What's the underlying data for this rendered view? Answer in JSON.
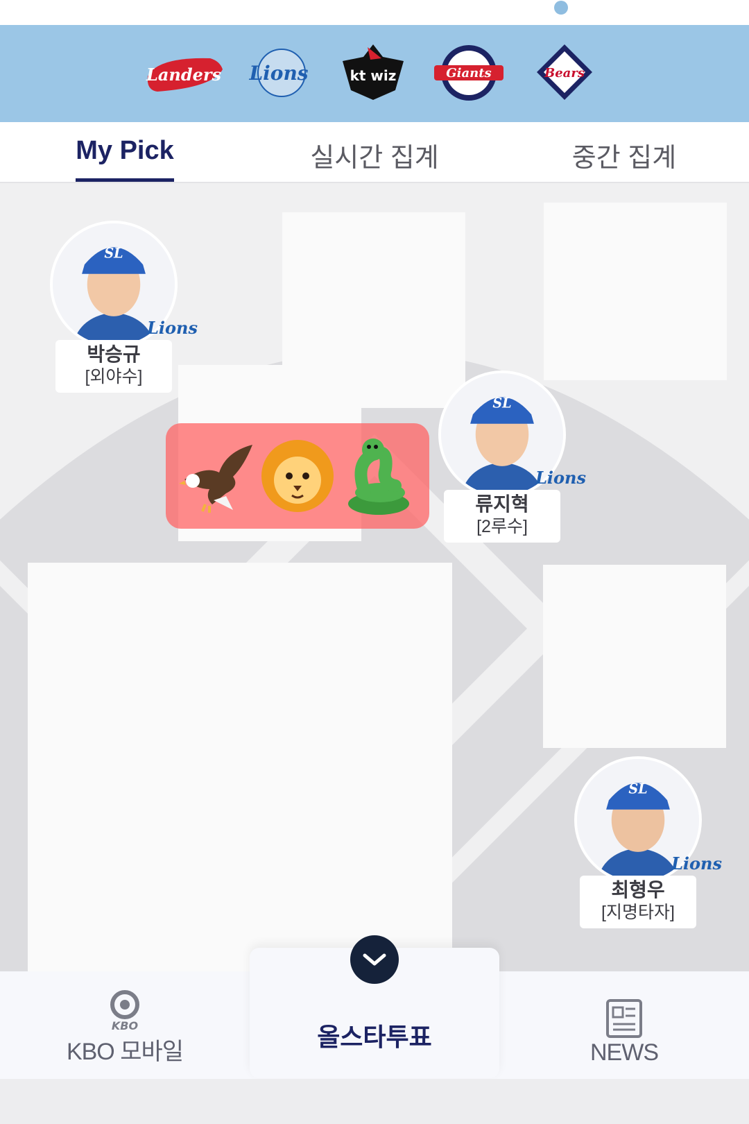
{
  "teams": [
    {
      "name": "Landers",
      "color": "#d6212f",
      "icon": "ssg-landers-logo"
    },
    {
      "name": "Lions",
      "color": "#1f5fb0",
      "icon": "samsung-lions-logo"
    },
    {
      "name": "kt wiz",
      "color": "#111111",
      "icon": "kt-wiz-logo"
    },
    {
      "name": "Giants",
      "color": "#d6212f",
      "icon": "lotte-giants-logo"
    },
    {
      "name": "Bears",
      "color": "#1c2363",
      "icon": "doosan-bears-logo"
    }
  ],
  "tabs": [
    "My Pick",
    "실시간 집계",
    "중간 집계"
  ],
  "players": [
    {
      "name": "박승규",
      "position": "[외야수]",
      "team": "Lions"
    },
    {
      "name": "류지혁",
      "position": "[2루수]",
      "team": "Lions"
    },
    {
      "name": "최형우",
      "position": "[지명타자]",
      "team": "Lions"
    }
  ],
  "emoji_overlay": [
    "eagle-emoji",
    "lion-emoji",
    "snake-emoji"
  ],
  "bottom_nav": {
    "kbo": {
      "logo_text": "KBO",
      "label": "KBO 모바일"
    },
    "vote": {
      "label": "올스타투표"
    },
    "news": {
      "label": "NEWS"
    }
  },
  "colors": {
    "accent": "#1c2363",
    "header_bg": "#9bc6e6",
    "overlay": "#ff6464"
  }
}
